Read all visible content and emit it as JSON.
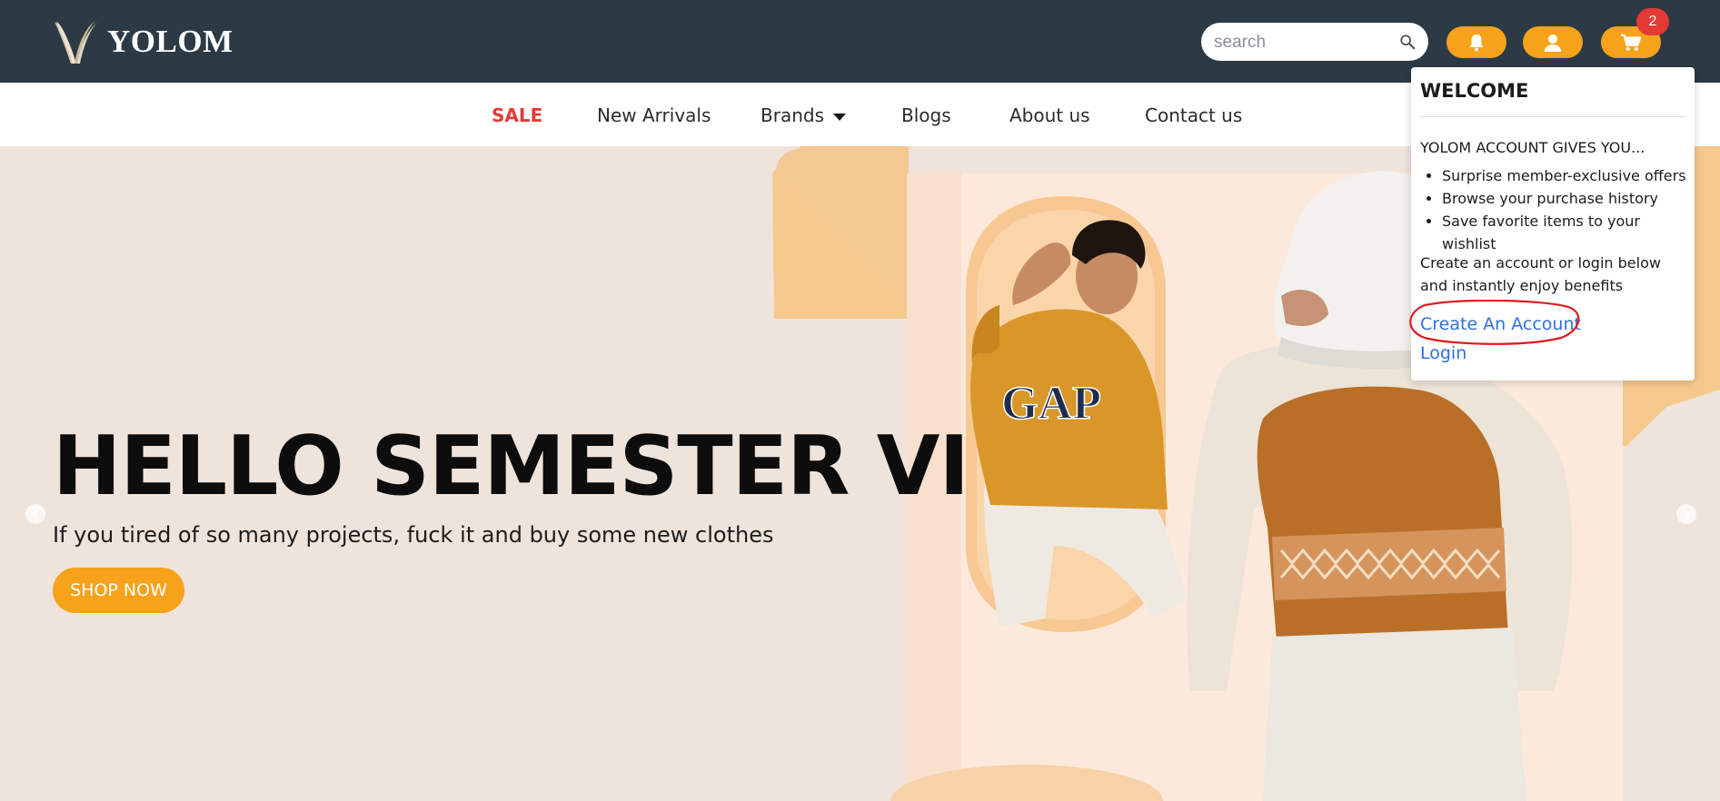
{
  "header": {
    "logo_text": "YOLOM",
    "search_placeholder": "search",
    "cart_count": "2",
    "icons": [
      "search-icon",
      "bell-icon",
      "user-icon",
      "cart-icon"
    ],
    "accent_color": "#f6a21b",
    "bar_color": "#2b3a45"
  },
  "nav": {
    "items": [
      {
        "label": "SALE"
      },
      {
        "label": "New Arrivals"
      },
      {
        "label": "Brands"
      },
      {
        "label": "Blogs"
      },
      {
        "label": "About us"
      },
      {
        "label": "Contact us"
      }
    ]
  },
  "hero": {
    "title": "HELLO SEMESTER VI",
    "subtitle": "If you tired of so many projects, fuck it and buy some new clothes",
    "cta_label": "SHOP NOW",
    "image_text": "GAP"
  },
  "account_dropdown": {
    "title": "WELCOME",
    "heading": "YOLOM ACCOUNT GIVES YOU...",
    "benefits": [
      "Surprise member-exclusive offers",
      "Browse your purchase history",
      "Save favorite items to your wishlist"
    ],
    "info_text": "Create an account or login below and instantly enjoy benefits",
    "create_account_label": "Create An Account",
    "login_label": "Login",
    "highlight_color": "#e0191f"
  }
}
